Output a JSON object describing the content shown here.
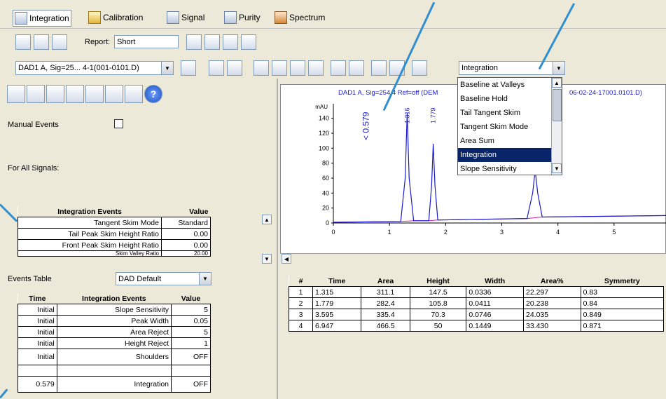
{
  "tabs": [
    {
      "label": "Integration",
      "icon": "integration-icon"
    },
    {
      "label": "Calibration",
      "icon": "calibration-icon"
    },
    {
      "label": "Signal",
      "icon": "signal-icon"
    },
    {
      "label": "Purity",
      "icon": "purity-icon"
    },
    {
      "label": "Spectrum",
      "icon": "spectrum-icon"
    }
  ],
  "report": {
    "label": "Report:",
    "value": "Short"
  },
  "signal_select": {
    "value": "DAD1 A, Sig=25... 4-1(001-0101.D)"
  },
  "mode_select": {
    "value": "Integration"
  },
  "dropdown_options": [
    "Baseline at Valleys",
    "Baseline Hold",
    "Tail Tangent Skim",
    "Tangent Skim Mode",
    "Area Sum",
    "Integration",
    "Slope Sensitivity"
  ],
  "dropdown_selected": "Integration",
  "left": {
    "manual_events_label": "Manual Events",
    "for_all_signals_label": "For All Signals:",
    "integration_events": {
      "header": [
        "Integration Events",
        "Value"
      ],
      "rows": [
        [
          "Tangent Skim Mode",
          "Standard"
        ],
        [
          "Tail Peak Skim Height Ratio",
          "0.00"
        ],
        [
          "Front Peak Skim Height Ratio",
          "0.00"
        ],
        [
          "Skim Valley Ratio",
          "20.00"
        ]
      ]
    },
    "events_table_label": "Events Table",
    "events_table_value": "DAD Default",
    "timed_events": {
      "header": [
        "Time",
        "Integration Events",
        "Value"
      ],
      "rows": [
        [
          "Initial",
          "Slope Sensitivity",
          "5"
        ],
        [
          "Initial",
          "Peak Width",
          "0.05"
        ],
        [
          "Initial",
          "Area Reject",
          "5"
        ],
        [
          "Initial",
          "Height Reject",
          "1"
        ],
        [
          "Initial",
          "Shoulders",
          "OFF"
        ],
        [
          "",
          "",
          ""
        ],
        [
          "0.579",
          "Integration",
          "OFF"
        ]
      ]
    }
  },
  "chart": {
    "title": "DAD1 A, Sig=254,4 Ref=off (DEM",
    "title_suffix": "06-02-24-17001.0101.D)",
    "y_unit": "mAU",
    "annotation": "< 0.579",
    "peak_labels": [
      "1.316",
      "1.779"
    ]
  },
  "chart_data": {
    "type": "line",
    "ylabel": "mAU",
    "ylim": [
      0,
      150
    ],
    "xlim": [
      0,
      6
    ],
    "yticks": [
      0,
      20,
      40,
      60,
      80,
      100,
      120,
      140
    ],
    "xticks": [
      0,
      1,
      2,
      3,
      4,
      5
    ],
    "series": [
      {
        "color": "#1a1acc",
        "x": [
          0,
          1.2,
          1.28,
          1.315,
          1.35,
          1.43,
          1.7,
          1.75,
          1.779,
          1.81,
          1.86,
          3.45,
          3.55,
          3.595,
          3.64,
          3.72,
          6
        ],
        "y": [
          1,
          2,
          60,
          147.5,
          60,
          3,
          3,
          50,
          105.8,
          50,
          4,
          6,
          40,
          70.3,
          40,
          8,
          10
        ]
      }
    ],
    "baseline": {
      "color": "#d01a9a",
      "x": [
        0,
        1.2,
        1.43,
        1.7,
        1.86,
        3.45,
        3.72,
        6
      ],
      "y": [
        1,
        2,
        3,
        3,
        4,
        6,
        8,
        10
      ]
    }
  },
  "results": {
    "header": [
      "#",
      "Time",
      "Area",
      "Height",
      "Width",
      "Area%",
      "Symmetry"
    ],
    "rows": [
      [
        "1",
        "1.315",
        "311.1",
        "147.5",
        "0.0336",
        "22.297",
        "0.83"
      ],
      [
        "2",
        "1.779",
        "282.4",
        "105.8",
        "0.0411",
        "20.238",
        "0.84"
      ],
      [
        "3",
        "3.595",
        "335.4",
        "70.3",
        "0.0746",
        "24.035",
        "0.849"
      ],
      [
        "4",
        "6.947",
        "466.5",
        "50",
        "0.1449",
        "33.430",
        "0.871"
      ]
    ]
  },
  "colors": {
    "trace": "#1a1acc",
    "baseline": "#d01a9a",
    "selection": "#0a246a",
    "callout": "#2f8fd0"
  }
}
